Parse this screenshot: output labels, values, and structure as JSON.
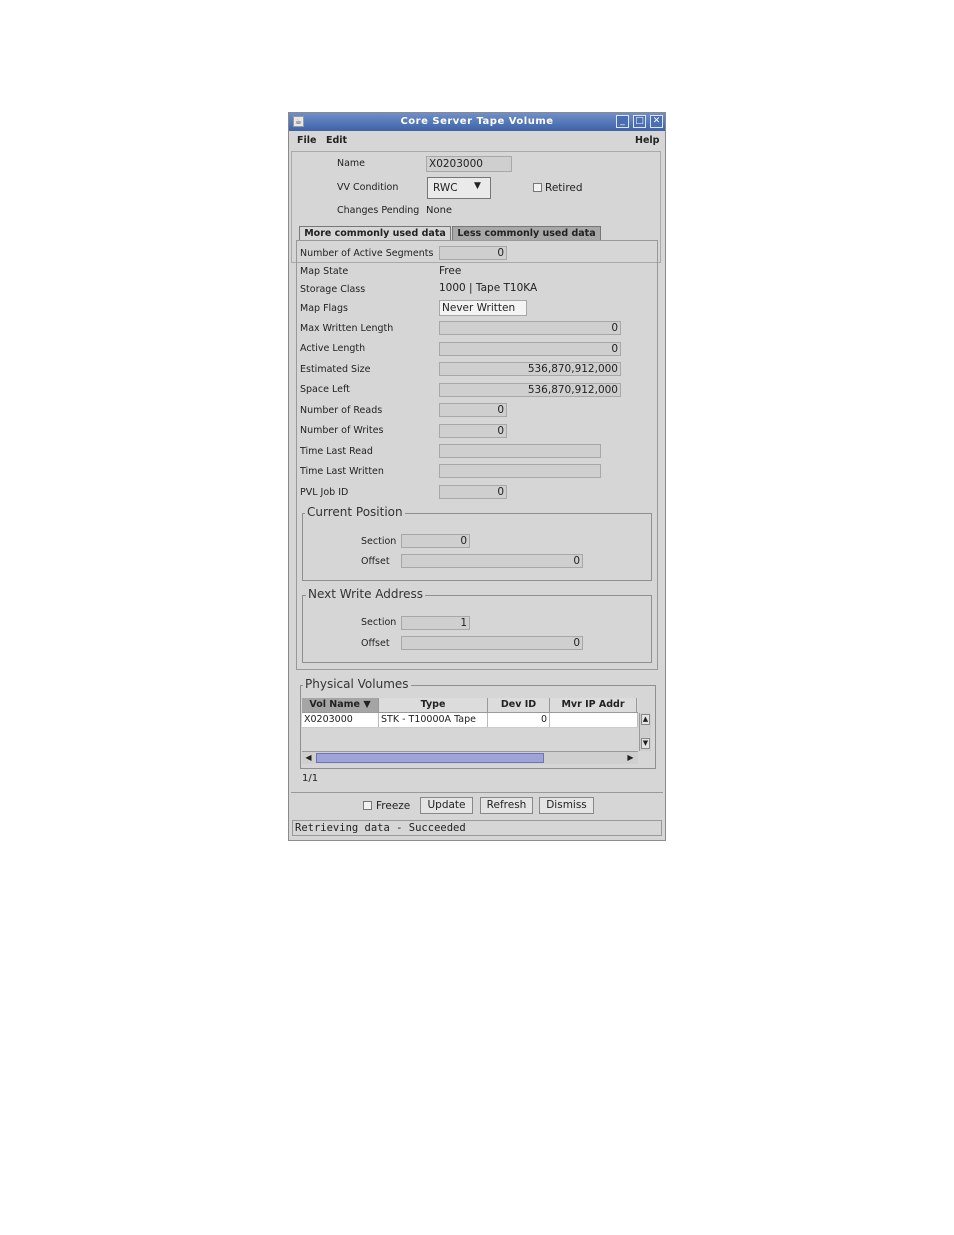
{
  "window": {
    "title": "Core Server Tape Volume",
    "app_icon": "java-icon"
  },
  "menu": {
    "file": "File",
    "edit": "Edit",
    "help": "Help"
  },
  "header": {
    "name_label": "Name",
    "name_value": "X0203000",
    "vv_condition_label": "VV Condition",
    "vv_condition_value": "RWC",
    "retired_label": "Retired",
    "changes_pending_label": "Changes Pending",
    "changes_pending_value": "None"
  },
  "tabs": {
    "more": "More commonly used data",
    "less": "Less commonly used data"
  },
  "fields": {
    "active_segments_label": "Number of Active Segments",
    "active_segments": "0",
    "map_state_label": "Map State",
    "map_state": "Free",
    "storage_class_label": "Storage Class",
    "storage_class": "1000 | Tape T10KA",
    "map_flags_label": "Map Flags",
    "map_flags": "Never Written",
    "max_written_length_label": "Max Written Length",
    "max_written_length": "0",
    "active_length_label": "Active Length",
    "active_length": "0",
    "estimated_size_label": "Estimated Size",
    "estimated_size": "536,870,912,000",
    "space_left_label": "Space Left",
    "space_left": "536,870,912,000",
    "number_of_reads_label": "Number of Reads",
    "number_of_reads": "0",
    "number_of_writes_label": "Number of Writes",
    "number_of_writes": "0",
    "time_last_read_label": "Time Last Read",
    "time_last_read": "",
    "time_last_written_label": "Time Last Written",
    "time_last_written": "",
    "pvl_job_id_label": "PVL Job ID",
    "pvl_job_id": "0"
  },
  "current_position": {
    "title": "Current Position",
    "section_label": "Section",
    "section": "0",
    "offset_label": "Offset",
    "offset": "0"
  },
  "next_write_address": {
    "title": "Next Write Address",
    "section_label": "Section",
    "section": "1",
    "offset_label": "Offset",
    "offset": "0"
  },
  "physical_volumes": {
    "title": "Physical Volumes",
    "columns": [
      "Vol Name",
      "Type",
      "Dev ID",
      "Mvr IP Addr"
    ],
    "rows": [
      [
        "X0203000",
        "STK - T10000A Tape",
        "0",
        ""
      ]
    ],
    "count": "1/1"
  },
  "bottom": {
    "freeze_label": "Freeze",
    "update": "Update",
    "refresh": "Refresh",
    "dismiss": "Dismiss"
  },
  "status": "Retrieving data - Succeeded"
}
